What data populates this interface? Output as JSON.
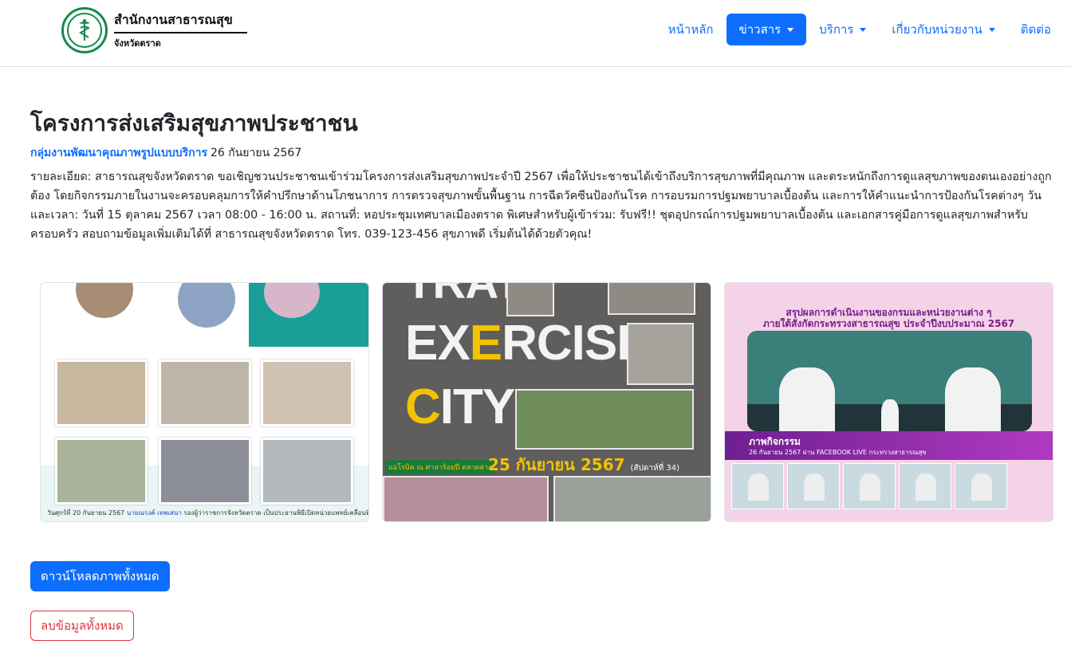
{
  "brand": {
    "title": "สำนักงานสาธารณสุข",
    "subtitle": "จังหวัดตราด"
  },
  "nav": {
    "items": [
      {
        "label": "หน้าหลัก",
        "dropdown": false,
        "active": false
      },
      {
        "label": "ข่าวสาร",
        "dropdown": true,
        "active": true
      },
      {
        "label": "บริการ",
        "dropdown": true,
        "active": false
      },
      {
        "label": "เกี่ยวกับหน่วยงาน",
        "dropdown": true,
        "active": false
      },
      {
        "label": "ติดต่อ",
        "dropdown": false,
        "active": false
      }
    ]
  },
  "article": {
    "title": "โครงการส่งเสริมสุขภาพประชาชน",
    "group": "กลุ่มงานพัฒนาคุณภาพรูปแบบบริการ",
    "date": "26 กันยายน 2567",
    "description": "รายละเอียด: สาธารณสุขจังหวัดตราด ขอเชิญชวนประชาชนเข้าร่วมโครงการส่งเสริมสุขภาพประจำปี 2567 เพื่อให้ประชาชนได้เข้าถึงบริการสุขภาพที่มีคุณภาพ และตระหนักถึงการดูแลสุขภาพของตนเองอย่างถูกต้อง โดยกิจกรรมภายในงานจะครอบคลุมการให้คำปรึกษาด้านโภชนาการ การตรวจสุขภาพขั้นพื้นฐาน การฉีดวัคซีนป้องกันโรค การอบรมการปฐมพยาบาลเบื้องต้น และการให้คำแนะนำการป้องกันโรคต่างๆ วันและเวลา: วันที่ 15 ตุลาคม 2567 เวลา 08:00 - 16:00 น. สถานที่: หอประชุมเทศบาลเมืองตราด พิเศษสำหรับผู้เข้าร่วม: รับฟรี!! ชุดอุปกรณ์การปฐมพยาบาลเบื้องต้น และเอกสารคู่มือการดูแลสุขภาพสำหรับครอบครัว สอบถามข้อมูลเพิ่มเติมได้ที่ สาธารณสุขจังหวัดตราด โทร. 039-123-456 สุขภาพดี เริ่มต้นได้ด้วยตัวคุณ!"
  },
  "gallery": {
    "image1": {
      "caption_prefix": "วันศุกร์ที่ 20 กันยายน 2567",
      "caption_name": "นายณรงค์ เทพเสนา",
      "caption_rest": "รองผู้ว่าราชการจังหวัดตราด เป็นประธานพิธีเปิดหน่วยแพทย์เคลื่อนที่"
    },
    "image2": {
      "line1": "TRAT",
      "line2a": "EX",
      "line2b": "E",
      "line2c": "RCISE",
      "line3a": "C",
      "line3b": "ITY",
      "tag": "แอโรบิค ณ ศาลาร้อยปี ตลาดล่าง",
      "date": "25 กันยายน 2567",
      "week": "(สัปดาห์ที่ 34)"
    },
    "image3": {
      "header1": "สรุปผลการดำเนินงานของกรมและหน่วยงานต่าง ๆ",
      "header2": "ภายใต้สังกัดกระทรวงสาธารณสุข ประจำปีงบประมาณ 2567",
      "band_title": "ภาพกิจกรรม",
      "band_sub": "26 กันยายน 2567 ผ่าน FACEBOOK LIVE กระทรวงสาธารณสุข"
    }
  },
  "actions": {
    "download_all": "ดาวน์โหลดภาพทั้งหมด",
    "delete_all": "ลบข้อมูลทั้งหมด"
  },
  "colors": {
    "primary": "#0d6efd",
    "danger": "#dc3545",
    "logo_green": "#138a4c"
  }
}
